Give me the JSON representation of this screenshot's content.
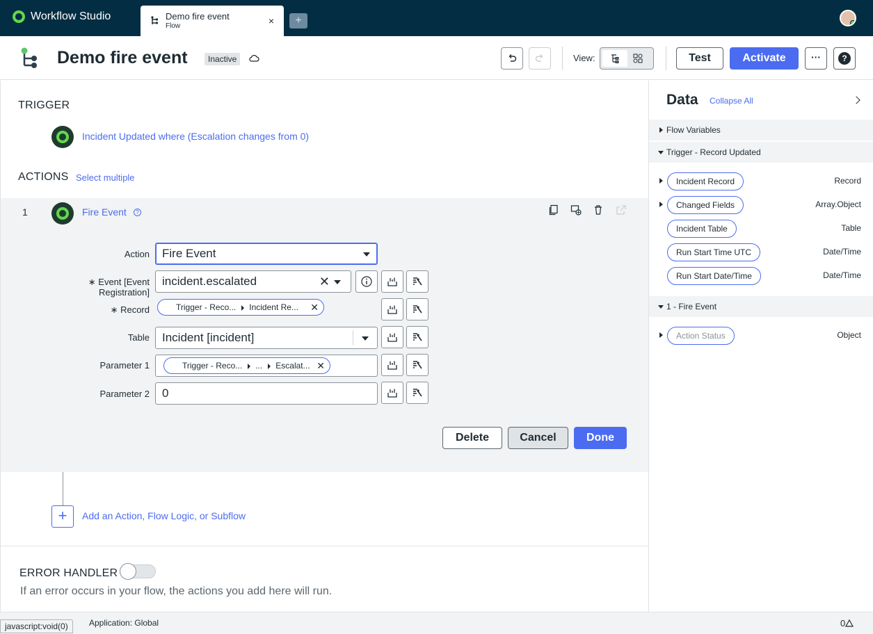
{
  "app": {
    "name": "Workflow Studio"
  },
  "tab": {
    "title": "Demo fire event",
    "subtitle": "Flow",
    "close": "×",
    "new_tab": "+"
  },
  "header": {
    "title": "Demo fire event",
    "status": "Inactive",
    "view_label": "View:",
    "test_label": "Test",
    "activate_label": "Activate",
    "more_label": "···",
    "help_label": "?"
  },
  "trigger": {
    "section_label": "TRIGGER",
    "text": "Incident Updated where (Escalation changes from 0)"
  },
  "actions": {
    "section_label": "ACTIONS",
    "select_multiple": "Select multiple",
    "item": {
      "number": "1",
      "name": "Fire Event",
      "fields": {
        "action": {
          "label": "Action",
          "value": "Fire Event"
        },
        "event": {
          "label_line1": "∗ Event [Event",
          "label_line2": "Registration]",
          "value": "incident.escalated",
          "clear": "✕"
        },
        "record": {
          "label": "∗ Record",
          "pill_part1": "Trigger - Reco...",
          "pill_part2": "Incident Re...",
          "remove": "✕"
        },
        "table": {
          "label": "Table",
          "value": "Incident [incident]"
        },
        "parameter1": {
          "label": "Parameter 1",
          "pill_part1": "Trigger - Reco...",
          "pill_part2": "...",
          "pill_part3": "Escalat...",
          "remove": "✕"
        },
        "parameter2": {
          "label": "Parameter 2",
          "value": "0"
        }
      },
      "buttons": {
        "delete": "Delete",
        "cancel": "Cancel",
        "done": "Done"
      }
    },
    "add_label": "Add an Action, Flow Logic, or Subflow",
    "add_icon": "+"
  },
  "error_handler": {
    "label": "ERROR HANDLER",
    "enabled": false,
    "hint": "If an error occurs in your flow, the actions you add here will run."
  },
  "data_panel": {
    "title": "Data",
    "collapse_all": "Collapse All",
    "sections": [
      {
        "label": "Flow Variables",
        "expanded": false
      },
      {
        "label": "Trigger - Record Updated",
        "expanded": true
      },
      {
        "label": "1 - Fire Event",
        "expanded": true
      }
    ],
    "trigger_items": [
      {
        "label": "Incident Record",
        "type": "Record",
        "expandable": true
      },
      {
        "label": "Changed Fields",
        "type": "Array.Object",
        "expandable": true
      },
      {
        "label": "Incident Table",
        "type": "Table",
        "expandable": false
      },
      {
        "label": "Run Start Time UTC",
        "type": "Date/Time",
        "expandable": false
      },
      {
        "label": "Run Start Date/Time",
        "type": "Date/Time",
        "expandable": false
      }
    ],
    "action_items": [
      {
        "label": "Action Status",
        "type": "Object",
        "expandable": true
      }
    ]
  },
  "status_bar": {
    "link_preview": "javascript:void(0)",
    "application": "Application: Global",
    "count": "0"
  },
  "colors": {
    "accent": "#4b6cf0",
    "topbar": "#032d42",
    "success": "#62d84e"
  }
}
